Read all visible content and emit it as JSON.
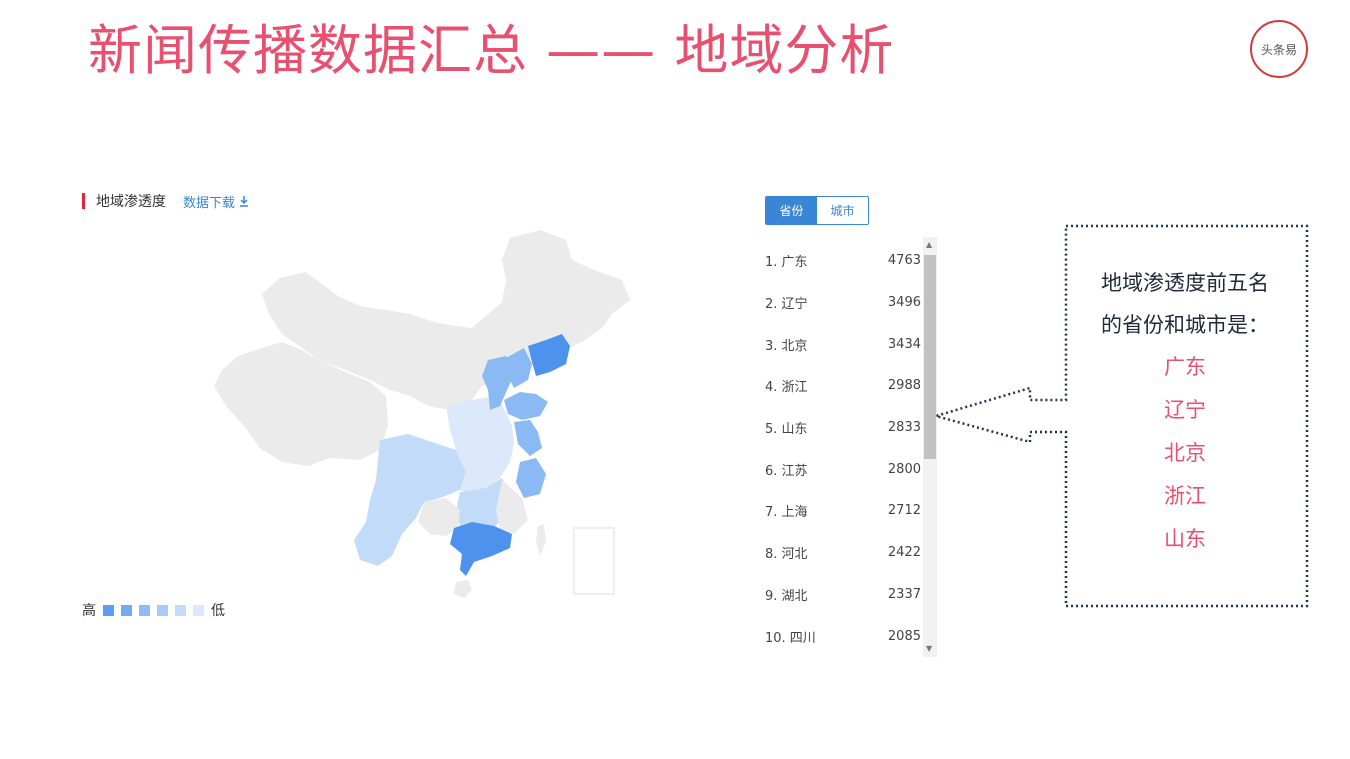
{
  "slide": {
    "title": "新闻传播数据汇总 —— 地域分析"
  },
  "logo": {
    "text": "头条易"
  },
  "panel": {
    "title": "地域渗透度",
    "download_label": "数据下载"
  },
  "legend": {
    "high_label": "高",
    "low_label": "低",
    "colors": [
      "#5b9ef0",
      "#74acf2",
      "#8fbcf4",
      "#a9ccf6",
      "#c3dcf9",
      "#dce9fb"
    ]
  },
  "tabs": [
    {
      "label": "省份",
      "active": true
    },
    {
      "label": "城市",
      "active": false
    }
  ],
  "ranking": [
    {
      "label": "1. 广东",
      "value": "4763"
    },
    {
      "label": "2. 辽宁",
      "value": "3496"
    },
    {
      "label": "3. 北京",
      "value": "3434"
    },
    {
      "label": "4. 浙江",
      "value": "2988"
    },
    {
      "label": "5. 山东",
      "value": "2833"
    },
    {
      "label": "6. 江苏",
      "value": "2800"
    },
    {
      "label": "7. 上海",
      "value": "2712"
    },
    {
      "label": "8. 河北",
      "value": "2422"
    },
    {
      "label": "9. 湖北",
      "value": "2337"
    },
    {
      "label": "10. 四川",
      "value": "2085"
    }
  ],
  "callout": {
    "lines": [
      "地域渗透度前五名",
      "的省份和城市是："
    ],
    "items": [
      "广东",
      "辽宁",
      "北京",
      "浙江",
      "山东"
    ]
  },
  "map_colors": {
    "base": "#ebebeb",
    "dark": "#4d92ec",
    "mid": "#8ab9f4",
    "light": "#c2dbf8",
    "pale": "#dbe9fb"
  }
}
